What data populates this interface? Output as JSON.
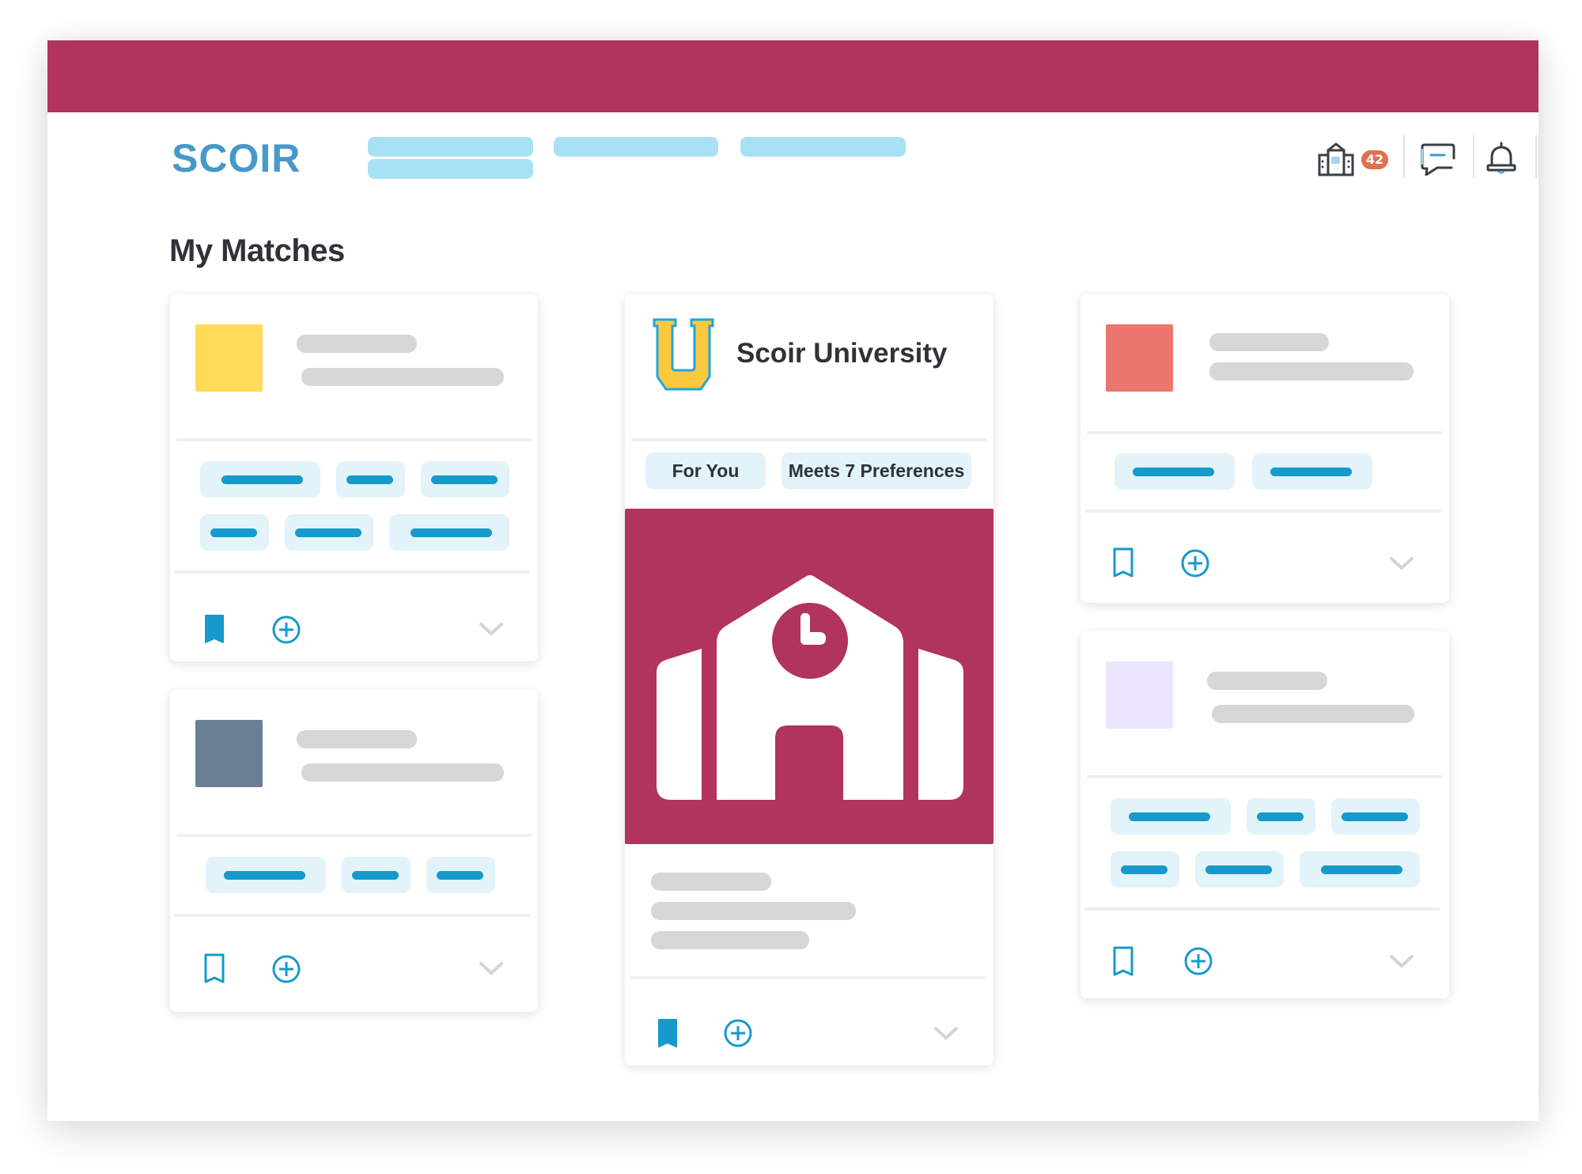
{
  "app": {
    "brand": "SCOIR",
    "brand_color": "#4699c9",
    "accent_color": "#b1345d"
  },
  "header": {
    "nav_placeholders": [
      "nav-item-1",
      "nav-item-2",
      "nav-item-3"
    ],
    "icons": [
      {
        "name": "colleges-icon",
        "badge": "42"
      },
      {
        "name": "messages-icon"
      },
      {
        "name": "notifications-icon"
      }
    ]
  },
  "main": {
    "title": "My Matches",
    "cards": [
      {
        "id": "card-1",
        "thumb_color": "#ffdb59",
        "bookmarked": true,
        "chip_rows": 2
      },
      {
        "id": "card-2",
        "thumb_color": "#6a7f93",
        "bookmarked": false,
        "chip_rows": 1
      },
      {
        "id": "featured",
        "name": "Scoir University",
        "logo_letter": "U",
        "tags": [
          "For You",
          "Meets 7 Preferences"
        ],
        "bookmarked": true
      },
      {
        "id": "card-3",
        "thumb_color": "#ec766d",
        "bookmarked": false,
        "chip_rows": 1
      },
      {
        "id": "card-4",
        "thumb_color": "#ebe6fd",
        "bookmarked": false,
        "chip_rows": 2
      }
    ]
  }
}
